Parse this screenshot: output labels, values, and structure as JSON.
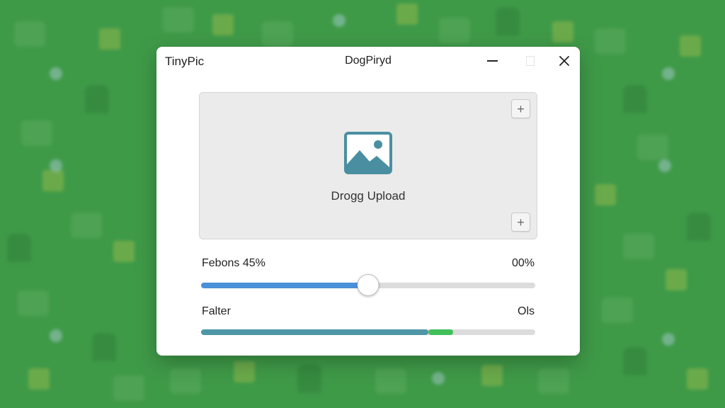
{
  "window": {
    "app_name": "TinyPic",
    "doc_title": "DogPiryd"
  },
  "dropzone": {
    "label": "Drogg Upload",
    "corner_buttons": [
      "+",
      "+"
    ],
    "icon": "image-icon"
  },
  "slider": {
    "label": "Febons 45%",
    "value_text": "00%",
    "level": 0.5
  },
  "filter": {
    "label": "Falter",
    "value_text": "Ols",
    "fill": 0.68,
    "highlight_start": 0.68,
    "highlight_end": 0.755
  },
  "colors": {
    "wallpaper": "#3f9a48",
    "accent_blue": "#4a90d9",
    "bar_teal": "#4f97a6",
    "accent_green": "#41c05a",
    "icon_teal": "#4a8fa1"
  }
}
